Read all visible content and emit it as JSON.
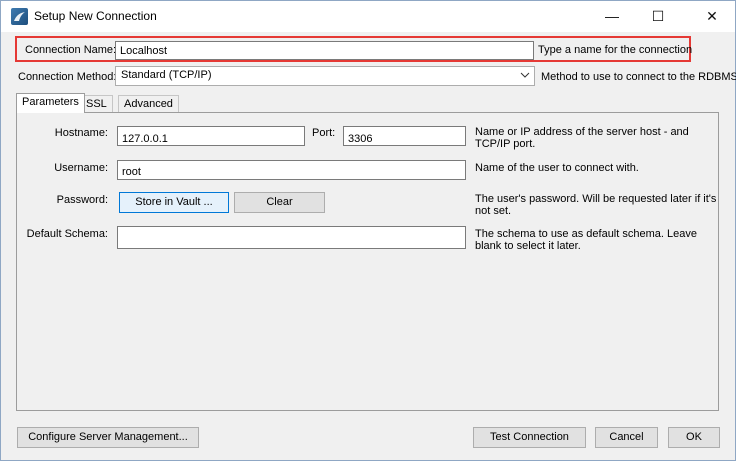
{
  "window": {
    "title": "Setup New Connection",
    "controls": {
      "minimize": "—",
      "maximize": "☐",
      "close": "✕"
    }
  },
  "connection_name": {
    "label": "Connection Name:",
    "value": "Localhost",
    "help": "Type a name for the connection"
  },
  "connection_method": {
    "label": "Connection Method:",
    "value": "Standard (TCP/IP)",
    "help": "Method to use to connect to the RDBMS"
  },
  "tabs": [
    {
      "label": "Parameters",
      "active": true
    },
    {
      "label": "SSL",
      "active": false
    },
    {
      "label": "Advanced",
      "active": false
    }
  ],
  "parameters": {
    "hostname": {
      "label": "Hostname:",
      "value": "127.0.0.1",
      "help": "Name or IP address of the server host - and TCP/IP port."
    },
    "port": {
      "label": "Port:",
      "value": "3306"
    },
    "username": {
      "label": "Username:",
      "value": "root",
      "help": "Name of the user to connect with."
    },
    "password": {
      "label": "Password:",
      "store_button": "Store in Vault ...",
      "clear_button": "Clear",
      "help": "The user's password. Will be requested later if it's not set."
    },
    "default_schema": {
      "label": "Default Schema:",
      "value": "",
      "help": "The schema to use as default schema. Leave blank to select it later."
    }
  },
  "footer": {
    "configure_button": "Configure Server Management...",
    "test_button": "Test Connection",
    "cancel_button": "Cancel",
    "ok_button": "OK"
  },
  "colors": {
    "highlight": "#e53935",
    "focus": "#0078d7"
  },
  "icons": {
    "app": "mysql-workbench-icon",
    "dropdown": "chevron-down-icon"
  }
}
